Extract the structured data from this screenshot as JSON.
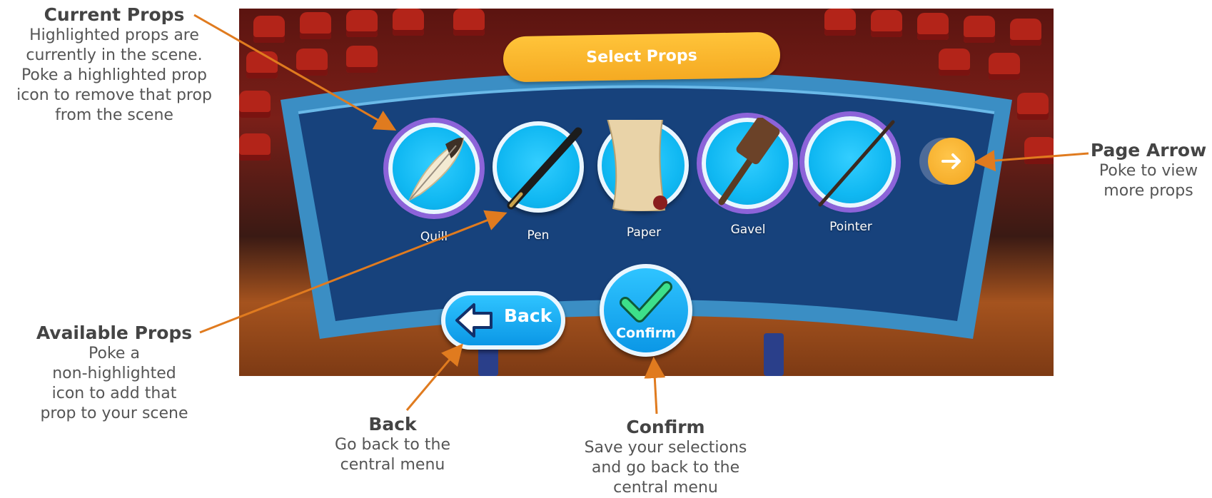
{
  "title_banner": "Select Props",
  "props": [
    {
      "label": "Quill",
      "icon": "quill-icon",
      "highlighted": true
    },
    {
      "label": "Pen",
      "icon": "pen-icon",
      "highlighted": false
    },
    {
      "label": "Paper",
      "icon": "paper-scroll-icon",
      "highlighted": false
    },
    {
      "label": "Gavel",
      "icon": "gavel-icon",
      "highlighted": true
    },
    {
      "label": "Pointer",
      "icon": "pointer-stick-icon",
      "highlighted": true
    }
  ],
  "back_button_label": "Back",
  "confirm_button_label": "Confirm",
  "callouts": {
    "current_props": {
      "title": "Current Props",
      "text": "Highlighted props are\ncurrently in the scene.\nPoke a highlighted prop\nicon to remove that prop\nfrom the scene"
    },
    "available_props": {
      "title": "Available Props",
      "text": "Poke a\nnon-highlighted\nicon to add that\nprop to your scene"
    },
    "page_arrow": {
      "title": "Page Arrow",
      "text": "Poke to view\nmore props"
    },
    "back": {
      "title": "Back",
      "text": "Go back to the\ncentral menu"
    },
    "confirm": {
      "title": "Confirm",
      "text": "Save your selections\nand go back to the\ncentral menu"
    }
  },
  "colors": {
    "callout_arrow": "#e07b1f",
    "banner": "#f5aa22",
    "prop_circle": "#10b8f2",
    "highlight_ring": "#8c63d9",
    "board_frame": "#3b8ec4",
    "board_panel": "#17427c"
  }
}
